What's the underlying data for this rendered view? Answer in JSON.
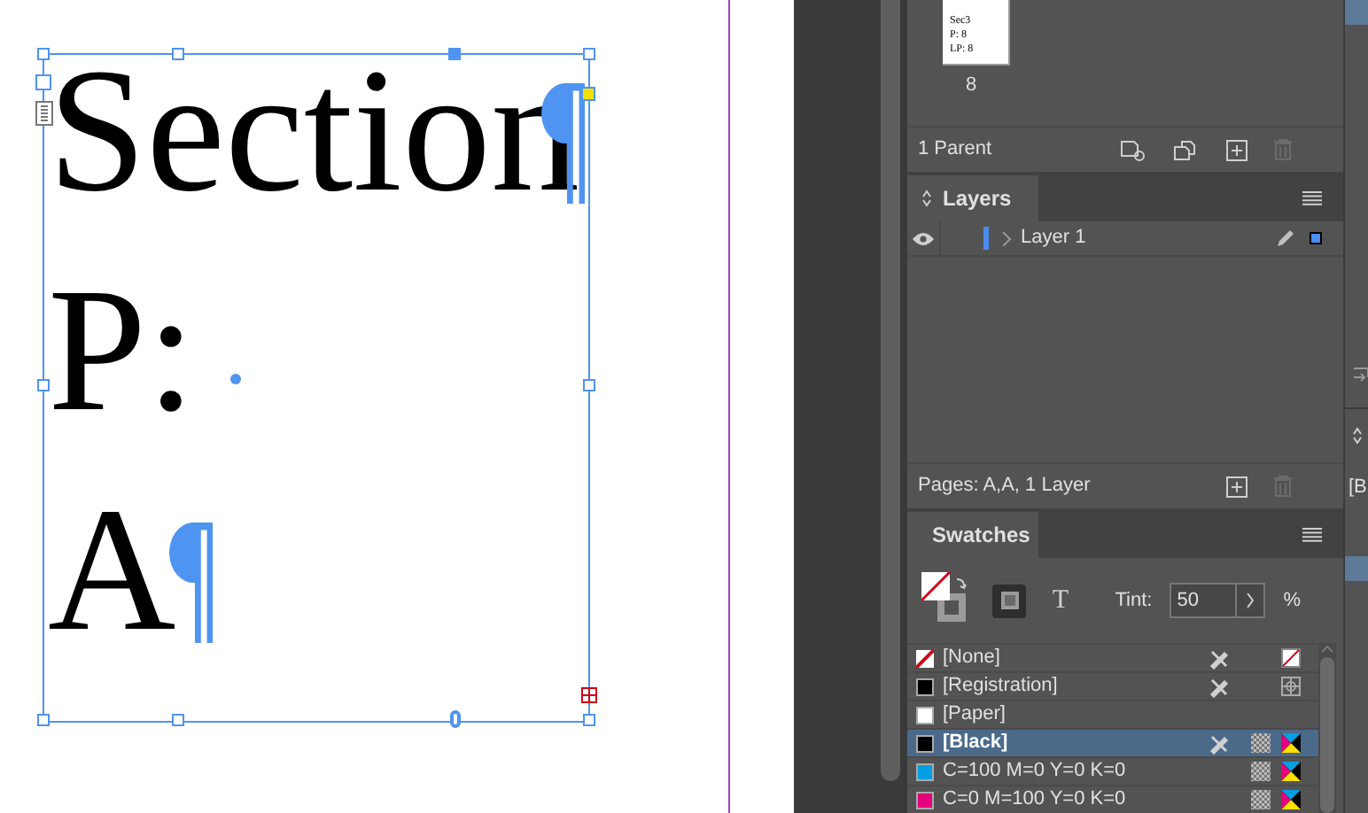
{
  "document": {
    "lines": [
      {
        "text": "Section",
        "pilcrow": true,
        "space_marker": false
      },
      {
        "text": "P:",
        "pilcrow": false,
        "space_marker": true
      },
      {
        "text": "A",
        "pilcrow": true,
        "space_marker": false
      }
    ]
  },
  "pages_panel": {
    "thumbnail_lines": [
      "Sec3",
      "P: 8",
      "LP: 8"
    ],
    "page_number": "8",
    "footer": "1 Parent"
  },
  "layers_panel": {
    "title": "Layers",
    "layers": [
      {
        "name": "Layer 1",
        "visible": true,
        "color": "#4a8cf0"
      }
    ],
    "footer": "Pages: A,A, 1 Layer"
  },
  "swatches_panel": {
    "title": "Swatches",
    "format_buttons": [
      {
        "kind": "container",
        "selected": true
      },
      {
        "kind": "text",
        "label": "T",
        "selected": false
      }
    ],
    "tint_label": "Tint:",
    "tint_value": "50",
    "percent": "%",
    "swatches": [
      {
        "name": "[None]",
        "kind": "none",
        "color": "#ffffff",
        "locked": true,
        "selected": false
      },
      {
        "name": "[Registration]",
        "kind": "registration",
        "color": "#000000",
        "locked": true,
        "selected": false
      },
      {
        "name": "[Paper]",
        "kind": "paper",
        "color": "#ffffff",
        "locked": false,
        "selected": false
      },
      {
        "name": "[Black]",
        "kind": "process",
        "color": "#000000",
        "locked": true,
        "selected": true
      },
      {
        "name": "C=100 M=0 Y=0 K=0",
        "kind": "process",
        "color": "#009fe3",
        "locked": false,
        "selected": false
      },
      {
        "name": "C=0 M=100 Y=0 K=0",
        "kind": "process",
        "color": "#e4007c",
        "locked": false,
        "selected": false
      }
    ]
  },
  "side_strip": {
    "text": "[B"
  }
}
